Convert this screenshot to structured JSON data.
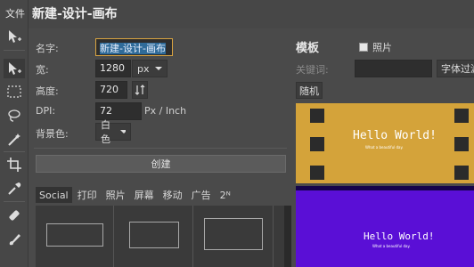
{
  "menu": {
    "file": "文件"
  },
  "title": "新建-设计-画布",
  "form": {
    "name_label": "名字:",
    "name_value": "新建-设计-画布",
    "width_label": "宽:",
    "width_value": "1280",
    "width_unit": "px",
    "height_label": "高度:",
    "height_value": "720",
    "dpi_label": "DPI:",
    "dpi_value": "72",
    "dpi_unit": "Px / Inch",
    "bg_label": "背景色:",
    "bg_value": "白色",
    "create_label": "创建"
  },
  "preset_tabs": [
    "Social",
    "打印",
    "照片",
    "屏幕",
    "移动",
    "广告",
    "2ᴺ"
  ],
  "templates": {
    "title": "模板",
    "photo_label": "照片",
    "keyword_label": "关键词:",
    "filter_label": "字体过滤",
    "random_label": "随机",
    "items": [
      {
        "title": "Hello World!",
        "subtitle": "What a beautiful day.",
        "bg": "#d4a33a"
      },
      {
        "title": "Hello World!",
        "subtitle": "What a beautiful day.",
        "bg": "#5a0fd6"
      }
    ]
  },
  "colors": {
    "accent": "#d9a441",
    "selection": "#2f6b99"
  }
}
